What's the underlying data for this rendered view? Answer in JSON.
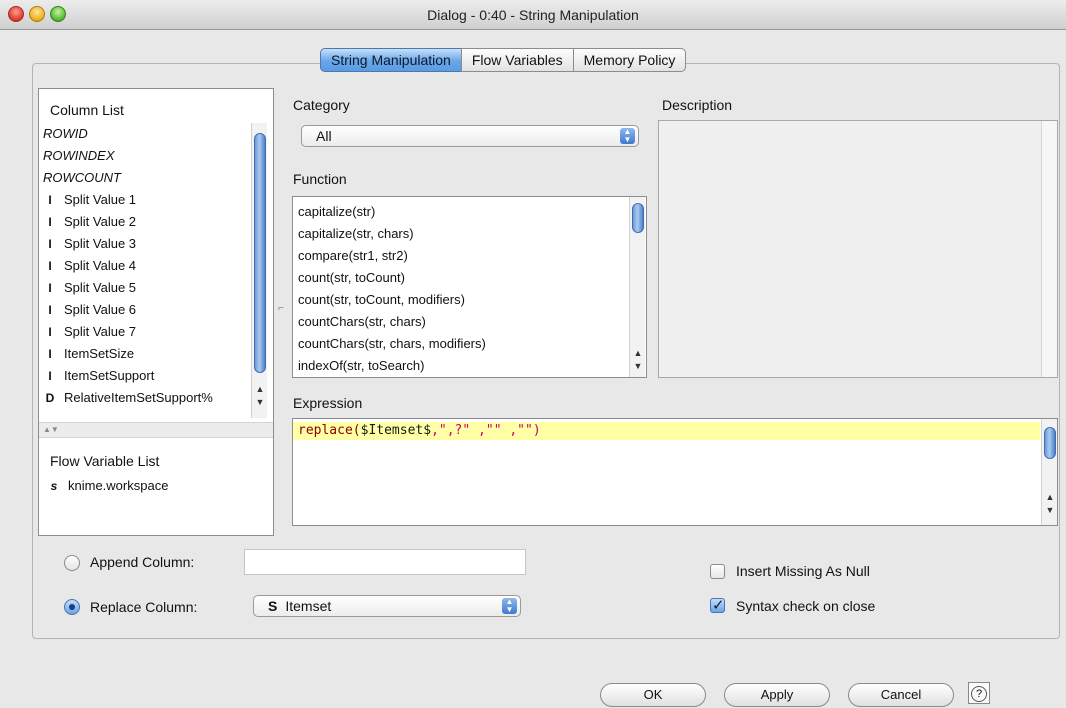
{
  "window": {
    "title": "Dialog - 0:40 - String Manipulation"
  },
  "tabs": [
    {
      "label": "String Manipulation"
    },
    {
      "label": "Flow Variables"
    },
    {
      "label": "Memory Policy"
    }
  ],
  "column_list": {
    "label": "Column List",
    "items": [
      {
        "icon": "",
        "label": "ROWID"
      },
      {
        "icon": "",
        "label": "ROWINDEX"
      },
      {
        "icon": "",
        "label": "ROWCOUNT"
      },
      {
        "icon": "I",
        "label": "Split Value 1"
      },
      {
        "icon": "I",
        "label": "Split Value 2"
      },
      {
        "icon": "I",
        "label": "Split Value 3"
      },
      {
        "icon": "I",
        "label": "Split Value 4"
      },
      {
        "icon": "I",
        "label": "Split Value 5"
      },
      {
        "icon": "I",
        "label": "Split Value 6"
      },
      {
        "icon": "I",
        "label": "Split Value 7"
      },
      {
        "icon": "I",
        "label": "ItemSetSize"
      },
      {
        "icon": "I",
        "label": "ItemSetSupport"
      },
      {
        "icon": "D",
        "label": "RelativeItemSetSupport%"
      }
    ]
  },
  "flow_variable_list": {
    "label": "Flow Variable List",
    "items": [
      {
        "icon": "s",
        "label": "knime.workspace"
      }
    ]
  },
  "category": {
    "label": "Category",
    "selected": "All"
  },
  "function": {
    "label": "Function",
    "items": [
      "capitalize(str)",
      "capitalize(str, chars)",
      "compare(str1, str2)",
      "count(str, toCount)",
      "count(str, toCount, modifiers)",
      "countChars(str, chars)",
      "countChars(str, chars, modifiers)",
      "indexOf(str, toSearch)"
    ]
  },
  "description": {
    "label": "Description"
  },
  "expression": {
    "label": "Expression",
    "fn": "replace(",
    "col": "$Itemset$",
    "args": ",\",?\" ,\"\" ,\"\")"
  },
  "append_column": {
    "label": "Append Column:",
    "value": ""
  },
  "replace_column": {
    "label": "Replace Column:",
    "icon": "S",
    "selected": "Itemset"
  },
  "insert_missing": {
    "label": "Insert Missing As Null"
  },
  "syntax_check": {
    "label": "Syntax check on close"
  },
  "buttons": {
    "ok": "OK",
    "apply": "Apply",
    "cancel": "Cancel",
    "help": "?"
  }
}
